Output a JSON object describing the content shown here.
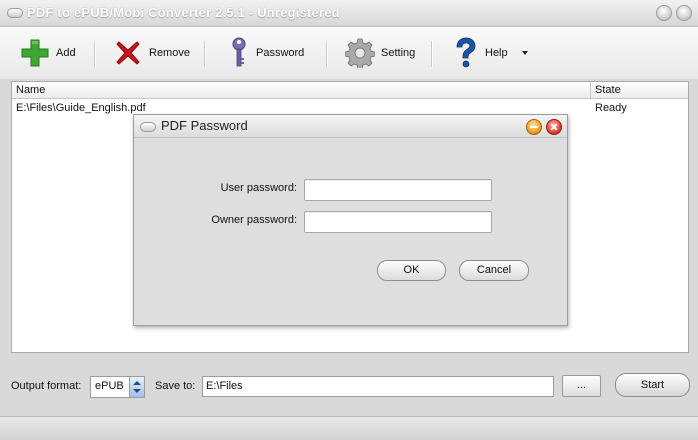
{
  "window": {
    "title": "PDF to ePUB/Mobi Converter 2.5.1 - Unregistered"
  },
  "toolbar": {
    "add_label": "Add",
    "remove_label": "Remove",
    "password_label": "Password",
    "setting_label": "Setting",
    "help_label": "Help",
    "icons": {
      "add": "plus-icon",
      "remove": "x-icon",
      "password": "key-icon",
      "setting": "gear-icon",
      "help": "question-icon",
      "help_menu": "dropdown-arrow-icon"
    }
  },
  "file_list": {
    "columns": [
      "Name",
      "State"
    ],
    "rows": [
      {
        "name": "E:\\Files\\Guide_English.pdf",
        "state": "Ready"
      }
    ]
  },
  "dialog": {
    "title": "PDF Password",
    "user_password_label": "User password:",
    "user_password_value": "",
    "owner_password_label": "Owner password:",
    "owner_password_value": "",
    "ok_label": "OK",
    "cancel_label": "Cancel"
  },
  "bottom": {
    "output_format_label": "Output format:",
    "output_format_value": "ePUB",
    "save_to_label": "Save to:",
    "save_to_value": "E:\\Files",
    "browse_label": "...",
    "start_label": "Start"
  },
  "colors": {
    "add_green": "#3fa535",
    "remove_red": "#c8161e",
    "help_blue": "#1b54a8",
    "close_red": "#e23b2c",
    "minimize_orange": "#f09a1a"
  }
}
